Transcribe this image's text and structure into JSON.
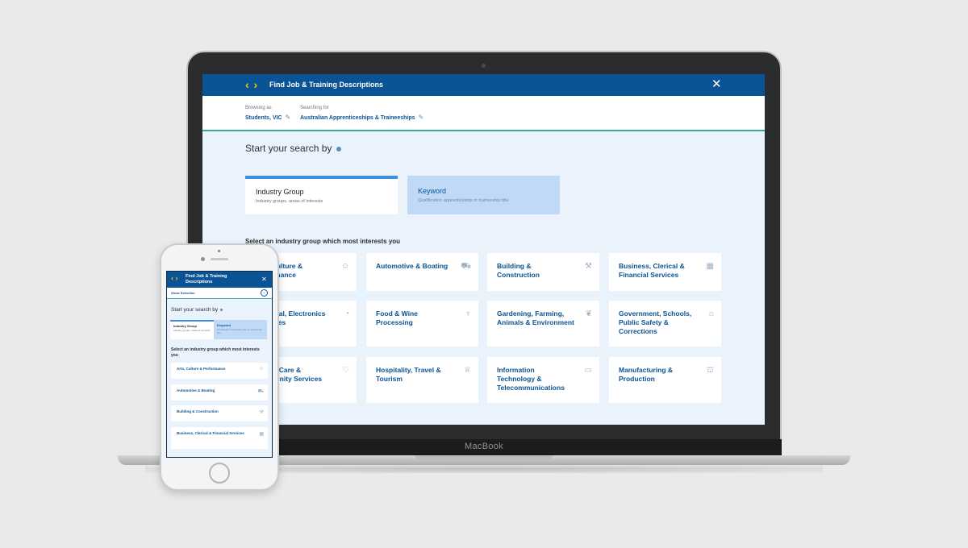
{
  "desktop": {
    "app_title": "Find Job & Training Descriptions",
    "logo_glyph": "‹ ›",
    "close_glyph": "✕",
    "browsing_label": "Browsing as",
    "browsing_value": "Students, VIC",
    "searching_label": "Searching for",
    "searching_value": "Australian Apprenticeships & Traineeships",
    "start_search": "Start your search by",
    "tabs": [
      {
        "title": "Industry Group",
        "subtitle": "Industry groups, areas of interests"
      },
      {
        "title": "Keyword",
        "subtitle": "Qualification apprenticeship or traineeship title"
      }
    ],
    "select_prompt": "Select an industry group which most interests you",
    "cards": [
      {
        "label": "Arts, Culture & Performance",
        "icon": "masks-icon"
      },
      {
        "label": "Automotive & Boating",
        "icon": "car-icon"
      },
      {
        "label": "Building & Construction",
        "icon": "drill-icon"
      },
      {
        "label": "Business, Clerical & Financial Services",
        "icon": "calculator-icon"
      },
      {
        "label": "Electrical, Electronics & Utilities",
        "icon": "gauge-icon"
      },
      {
        "label": "Food & Wine Processing",
        "icon": "wine-glass-icon"
      },
      {
        "label": "Gardening, Farming, Animals & Environment",
        "icon": "plant-icon"
      },
      {
        "label": "Government, Schools, Public Safety & Corrections",
        "icon": "building-icon"
      },
      {
        "label": "Health, Care & Community Services",
        "icon": "heart-icon"
      },
      {
        "label": "Hospitality, Travel & Tourism",
        "icon": "chef-hat-icon"
      },
      {
        "label": "Information Technology & Telecommunications",
        "icon": "monitor-icon"
      },
      {
        "label": "Manufacturing & Production",
        "icon": "factory-icon"
      }
    ],
    "device_brand": "MacBook"
  },
  "mobile": {
    "app_title": "Find Job & Training Descriptions",
    "show_selection": "Show Selection",
    "start_search": "Start your search by",
    "tabs": [
      {
        "title": "Industry Group",
        "subtitle": "Industry groups, areas of interests"
      },
      {
        "title": "Keyword",
        "subtitle": "Qualification apprenticeship or traineeship title"
      }
    ],
    "select_prompt": "Select an industry group which most interests you",
    "cards": [
      {
        "label": "Arts, Culture & Performance",
        "icon": "masks-icon"
      },
      {
        "label": "Automotive & Boating",
        "icon": "car-icon"
      },
      {
        "label": "Building & Construction",
        "icon": "drill-icon"
      },
      {
        "label": "Business, Clerical & Financial Services",
        "icon": "calculator-icon"
      }
    ]
  },
  "colors": {
    "brand_blue": "#0a5394",
    "logo_yellow": "#ffc20e",
    "accent_teal": "#3aa9a0",
    "page_bg": "#eaf3fc"
  }
}
